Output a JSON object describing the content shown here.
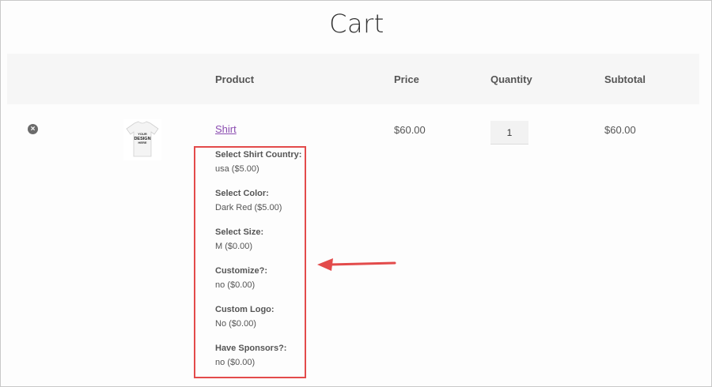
{
  "page": {
    "title": "Cart"
  },
  "table": {
    "headers": {
      "product": "Product",
      "price": "Price",
      "quantity": "Quantity",
      "subtotal": "Subtotal"
    }
  },
  "cart_item": {
    "remove_icon": "remove-circle-icon",
    "image_alt_icon": "tshirt-thumbnail",
    "thumbnail_text": "YOUR DESIGN HERE",
    "name": "Shirt",
    "price": "$60.00",
    "quantity": "1",
    "subtotal": "$60.00",
    "meta": [
      {
        "key": "Select Shirt Country:",
        "value": "usa ($5.00)"
      },
      {
        "key": "Select Color:",
        "value": "Dark Red ($5.00)"
      },
      {
        "key": "Select Size:",
        "value": "M ($0.00)"
      },
      {
        "key": "Customize?:",
        "value": "no ($0.00)"
      },
      {
        "key": "Custom Logo:",
        "value": "No ($0.00)"
      },
      {
        "key": "Have Sponsors?:",
        "value": "no ($0.00)"
      }
    ]
  },
  "colors": {
    "highlight": "#e34b4b",
    "link": "#8a4bb0"
  }
}
